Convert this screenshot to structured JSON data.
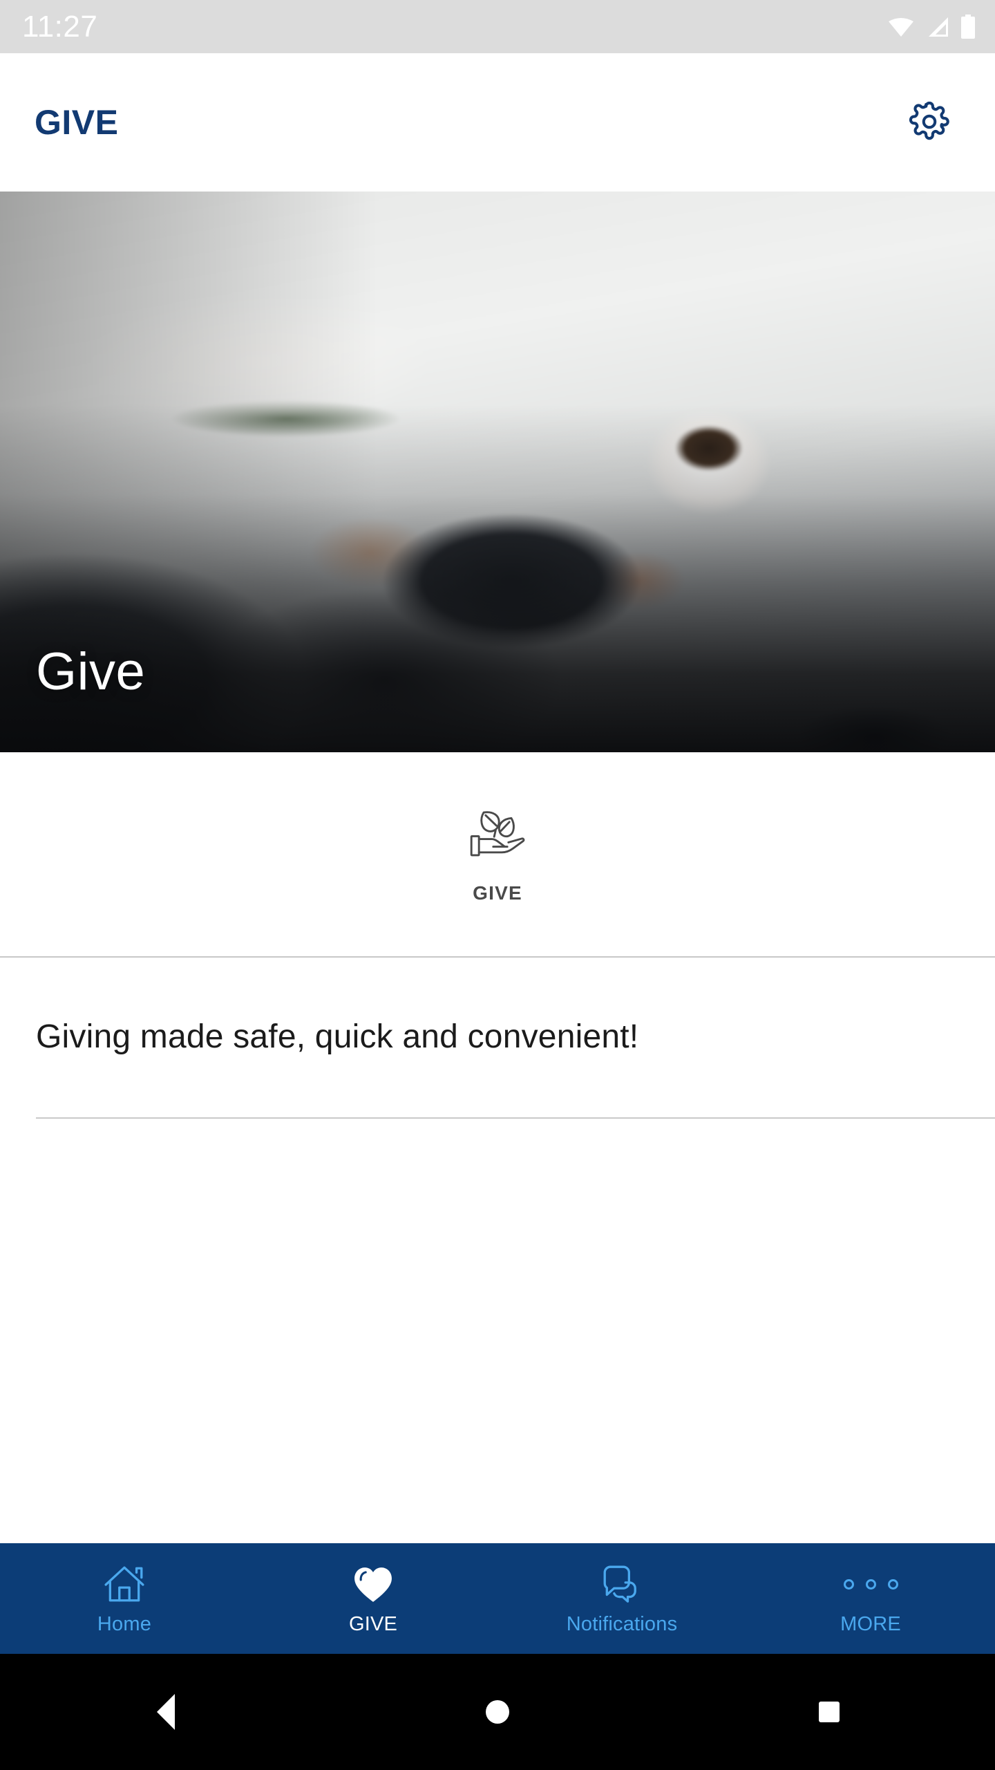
{
  "status_bar": {
    "time": "11:27",
    "icons": [
      "wifi-icon",
      "cellular-signal-icon",
      "battery-icon"
    ]
  },
  "app_bar": {
    "title": "GIVE",
    "settings_icon": "gear-icon"
  },
  "hero": {
    "caption": "Give",
    "image_alt": "hands using a tablet on a desk with coffee cup, notebook and phone"
  },
  "tile": {
    "label": "GIVE",
    "icon": "hand-with-leaves-icon"
  },
  "content": {
    "tagline": "Giving made safe, quick and convenient!"
  },
  "bottom_nav": {
    "items": [
      {
        "label": "Home",
        "icon": "home-icon",
        "active": false
      },
      {
        "label": "GIVE",
        "icon": "heart-icon",
        "active": true
      },
      {
        "label": "Notifications",
        "icon": "speech-bubbles-icon",
        "active": false
      },
      {
        "label": "MORE",
        "icon": "three-dots-icon",
        "active": false
      }
    ]
  },
  "system_nav": {
    "back": "back-triangle-icon",
    "home": "home-circle-icon",
    "recents": "recents-square-icon"
  },
  "colors": {
    "brand_navy": "#0c3d77",
    "title_navy": "#123a72",
    "nav_inactive_blue": "#4aa8ee",
    "nav_active_white": "#ffffff",
    "status_bar_bg": "#dcdcdc",
    "divider": "#c8c8c8",
    "tile_gray": "#4a4a4a"
  }
}
